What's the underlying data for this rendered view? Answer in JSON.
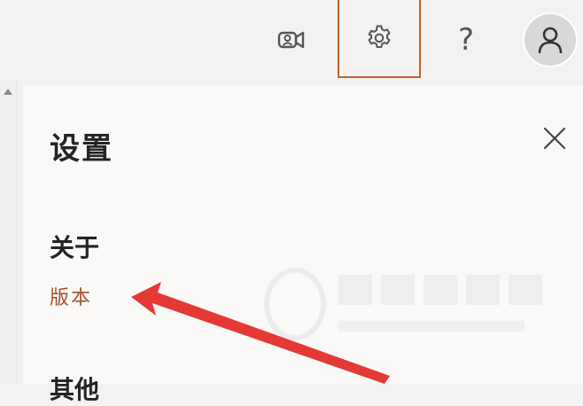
{
  "toolbar": {
    "meet_icon": "meet-now-icon",
    "settings_icon": "gear-icon",
    "help_label": "?",
    "avatar_icon": "person-icon",
    "settings_highlight_color": "#c0622b"
  },
  "settings_panel": {
    "title": "设置",
    "close_icon": "close-icon",
    "about_heading": "关于",
    "version_link": "版本",
    "other_heading": "其他"
  },
  "colors": {
    "link": "#a4522a",
    "arrow": "#e53935",
    "text": "#252423"
  }
}
